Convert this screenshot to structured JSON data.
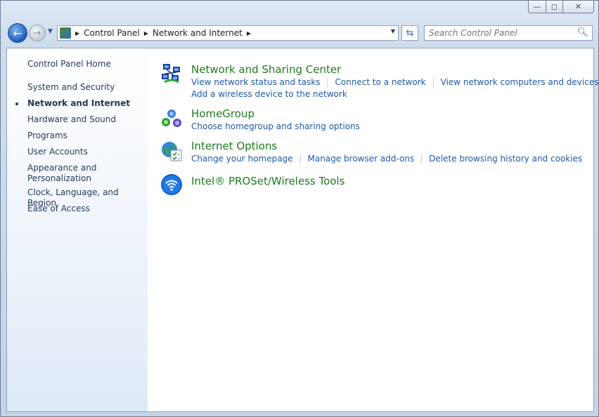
{
  "window": {
    "caption": {
      "min_glyph": "▭",
      "max_glyph": "◻",
      "close_glyph": "✕"
    }
  },
  "nav": {
    "back_glyph": "←",
    "forward_glyph": "→",
    "breadcrumb": [
      "Control Panel",
      "Network and Internet"
    ],
    "search_placeholder": "Search Control Panel",
    "refresh_glyph": "⇆",
    "search_glyph": "⌕"
  },
  "sidebar": {
    "home": "Control Panel Home",
    "items": [
      {
        "label": "System and Security",
        "active": false
      },
      {
        "label": "Network and Internet",
        "active": true
      },
      {
        "label": "Hardware and Sound",
        "active": false
      },
      {
        "label": "Programs",
        "active": false
      },
      {
        "label": "User Accounts",
        "active": false
      },
      {
        "label": "Appearance and",
        "label2": "Personalization",
        "active": false
      },
      {
        "label": "Clock, Language, and Region",
        "active": false
      },
      {
        "label": "Ease of Access",
        "active": false
      }
    ]
  },
  "categories": [
    {
      "title": "Network and Sharing Center",
      "icon": "network-sharing-icon",
      "links": [
        "View network status and tasks",
        "Connect to a network",
        "View network computers and devices"
      ],
      "links2": [
        "Add a wireless device to the network"
      ]
    },
    {
      "title": "HomeGroup",
      "icon": "homegroup-icon",
      "links": [
        "Choose homegroup and sharing options"
      ]
    },
    {
      "title": "Internet Options",
      "icon": "internet-options-icon",
      "links": [
        "Change your homepage",
        "Manage browser add-ons",
        "Delete browsing history and cookies"
      ]
    },
    {
      "title": "Intel® PROSet/Wireless Tools",
      "icon": "intel-wireless-icon",
      "links": []
    }
  ],
  "colors": {
    "title_green": "#1e7a1e",
    "link_blue": "#1c59a8"
  }
}
